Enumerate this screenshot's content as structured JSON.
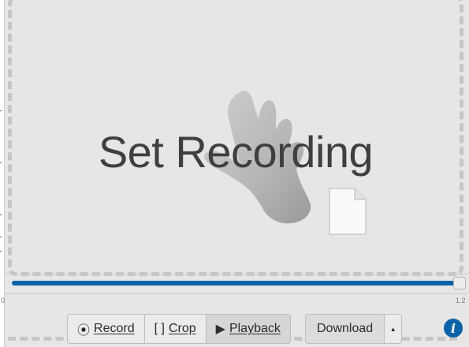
{
  "drop_zone": {
    "title": "Set Recording",
    "hand_icon": "hand-icon",
    "file_icon": "file-icon"
  },
  "timeline": {
    "start_label": "0",
    "end_label": "1.2",
    "progress": 1.0
  },
  "toolbar": {
    "record": {
      "icon": "record-circle-icon",
      "glyph": "⦿",
      "label": "Record"
    },
    "crop": {
      "icon": "crop-icon",
      "glyph": "[ ]",
      "label": "Crop"
    },
    "playback": {
      "icon": "play-icon",
      "glyph": "▶",
      "label": "Playback",
      "active": true
    },
    "download": {
      "label": "Download"
    },
    "download_menu": {
      "icon": "caret-up-icon",
      "glyph": "▲"
    }
  },
  "info": {
    "icon": "info-icon",
    "glyph": "i"
  },
  "colors": {
    "accent": "#0a63a6",
    "background": "#e6e6e6",
    "dashed_border": "#c6c6c6",
    "title_text": "#3f3f3f"
  }
}
